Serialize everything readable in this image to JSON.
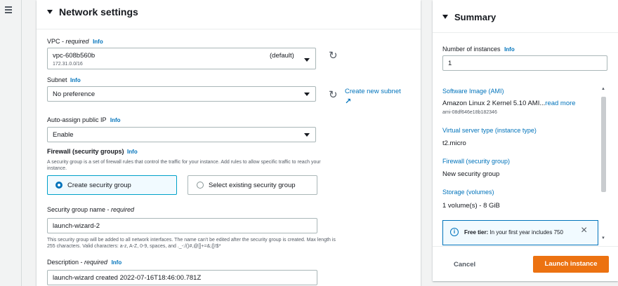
{
  "left_nav": {
    "icon": "hamburger-menu-icon"
  },
  "network": {
    "title": "Network settings",
    "vpc": {
      "label": "VPC - ",
      "required": "required",
      "info": "Info",
      "value": "vpc-608b560b",
      "sub": "172.31.0.0/16",
      "tag": "(default)"
    },
    "subnet": {
      "label": "Subnet",
      "info": "Info",
      "value": "No preference",
      "create_link": "Create new subnet"
    },
    "public_ip": {
      "label": "Auto-assign public IP",
      "info": "Info",
      "value": "Enable"
    },
    "firewall": {
      "label": "Firewall (security groups)",
      "info": "Info",
      "desc_line1": "A security group is a set of firewall rules that control the traffic for your instance. Add rules to allow specific traffic to reach your",
      "desc_line2": "instance.",
      "option_create": "Create security group",
      "option_select": "Select existing security group",
      "selected": "create"
    },
    "sg_name": {
      "label": "Security group name - ",
      "required": "required",
      "value": "launch-wizard-2",
      "hint_line1": "This security group will be added to all network interfaces. The name can't be edited after the security group is created. Max length is",
      "hint_line2": "255 characters. Valid characters: a-z, A-Z, 0-9, spaces, and ._-:/()#,@[]+=&;{}!$*"
    },
    "description": {
      "label": "Description - ",
      "required": "required",
      "info": "Info",
      "value": "launch-wizard created 2022-07-16T18:46:00.781Z"
    }
  },
  "summary": {
    "title": "Summary",
    "instances_label": "Number of instances",
    "instances_info": "Info",
    "instances_value": "1",
    "ami_label": "Software Image (AMI)",
    "ami_value": "Amazon Linux 2 Kernel 5.10 AMI...",
    "ami_more": "read more",
    "ami_id": "ami-08df646e18b182346",
    "type_label": "Virtual server type (instance type)",
    "type_value": "t2.micro",
    "fw_label": "Firewall (security group)",
    "fw_value": "New security group",
    "storage_label": "Storage (volumes)",
    "storage_value": "1 volume(s) - 8 GiB",
    "free_tier_bold": "Free tier:",
    "free_tier_text": " In your first year includes 750",
    "cancel": "Cancel",
    "launch": "Launch instance"
  },
  "colors": {
    "accent": "#0073bb",
    "primary_button": "#ec7211",
    "selected_border": "#00a1c9"
  }
}
